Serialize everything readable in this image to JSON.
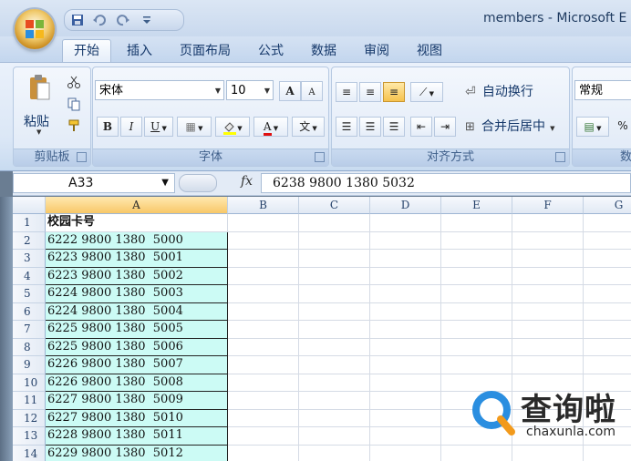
{
  "window": {
    "title": "members - Microsoft E"
  },
  "tabs": [
    {
      "label": "开始",
      "active": true
    },
    {
      "label": "插入"
    },
    {
      "label": "页面布局"
    },
    {
      "label": "公式"
    },
    {
      "label": "数据"
    },
    {
      "label": "审阅"
    },
    {
      "label": "视图"
    }
  ],
  "ribbon": {
    "clipboard": {
      "paste_label": "粘贴",
      "group_label": "剪贴板"
    },
    "font": {
      "font_name": "宋体",
      "font_size": "10",
      "bold": "B",
      "italic": "I",
      "underline": "U",
      "wen": "文",
      "group_label": "字体"
    },
    "alignment": {
      "wrap_label": "自动换行",
      "merge_label": "合并后居中",
      "group_label": "对齐方式"
    },
    "number": {
      "format": "常规",
      "percent": "%",
      "group_label": "数"
    }
  },
  "formula_bar": {
    "name_box": "A33",
    "fx": "fx",
    "formula": "6238 9800 1380  5032"
  },
  "grid": {
    "columns": [
      "A",
      "B",
      "C",
      "D",
      "E",
      "F",
      "G"
    ],
    "rows": [
      {
        "num": "1",
        "a": "校园卡号"
      },
      {
        "num": "2",
        "a": "6222 9800 1380  5000"
      },
      {
        "num": "3",
        "a": "6223 9800 1380  5001"
      },
      {
        "num": "4",
        "a": "6223 9800 1380  5002"
      },
      {
        "num": "5",
        "a": "6224 9800 1380  5003"
      },
      {
        "num": "6",
        "a": "6224 9800 1380  5004"
      },
      {
        "num": "7",
        "a": "6225 9800 1380  5005"
      },
      {
        "num": "8",
        "a": "6225 9800 1380  5006"
      },
      {
        "num": "9",
        "a": "6226 9800 1380  5007"
      },
      {
        "num": "10",
        "a": "6226 9800 1380  5008"
      },
      {
        "num": "11",
        "a": "6227 9800 1380  5009"
      },
      {
        "num": "12",
        "a": "6227 9800 1380  5010"
      },
      {
        "num": "13",
        "a": "6228 9800 1380  5011"
      },
      {
        "num": "14",
        "a": "6229 9800 1380  5012"
      }
    ]
  },
  "watermark": {
    "brand": "查询啦",
    "url": "chaxunla.com"
  },
  "colors": {
    "cell_fill": "#ccfbf5",
    "accent": "#2a8ee0",
    "selected_header": "#f8c768"
  }
}
